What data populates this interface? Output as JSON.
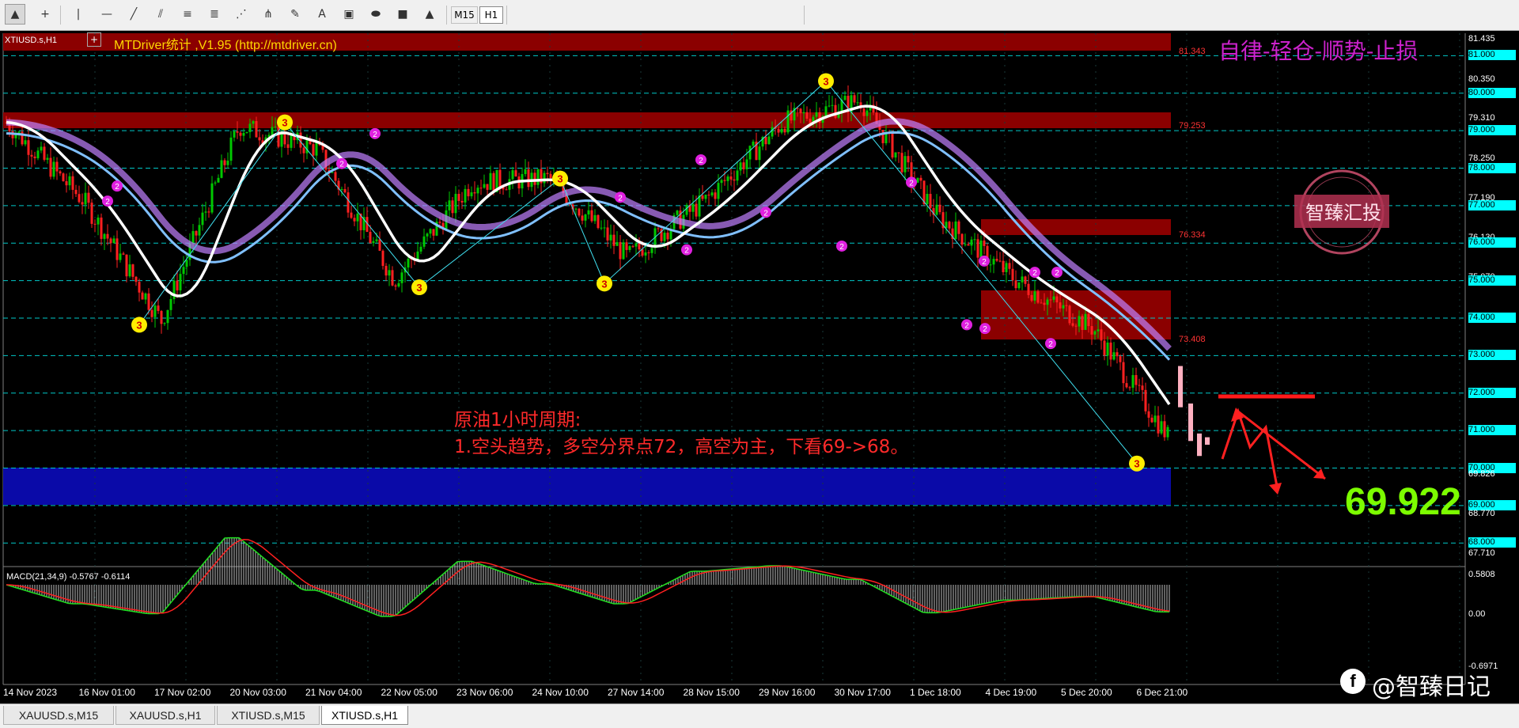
{
  "toolbar": {
    "timeframes": [
      "M15",
      "H1"
    ],
    "active_timeframe": "H1"
  },
  "chart": {
    "symbol": "XTIUSD.s,H1",
    "indicator_label": "MTDriver统计 ,V1.95 (http://mtdriver.cn)",
    "motto": "自律-轻仓-顺势-止损",
    "stamp": "智臻汇投",
    "price_big": "69.922",
    "annotation_title": "原油1小时周期:",
    "annotation_body": "1.空头趋势，多空分界点72，高空为主，下看69->68。",
    "macd_label": "MACD(21,34,9) -0.5767 -0.6114",
    "watermark": "@智臻日记",
    "price_levels": [
      "81.435",
      "81.000",
      "80.350",
      "80.000",
      "79.310",
      "79.000",
      "78.250",
      "78.000",
      "77.190",
      "77.000",
      "76.130",
      "76.000",
      "75.070",
      "75.000",
      "74.000",
      "73.000",
      "72.000",
      "71.000",
      "70.000",
      "69.826",
      "69.000",
      "68.770",
      "68.000",
      "67.710"
    ],
    "highlighted_levels": [
      "81.000",
      "80.000",
      "79.000",
      "78.000",
      "77.000",
      "76.000",
      "75.000",
      "74.000",
      "73.000",
      "72.000",
      "71.000",
      "70.000",
      "69.000",
      "68.000"
    ],
    "zone_labels": [
      "81.343",
      "79.253",
      "76.334",
      "73.408"
    ],
    "macd_levels": [
      "0.5808",
      "0.00",
      "-0.6971"
    ],
    "time_labels": [
      "14 Nov 2023",
      "16 Nov 01:00",
      "17 Nov 02:00",
      "20 Nov 03:00",
      "21 Nov 04:00",
      "22 Nov 05:00",
      "23 Nov 06:00",
      "24 Nov 10:00",
      "27 Nov 14:00",
      "28 Nov 15:00",
      "29 Nov 16:00",
      "30 Nov 17:00",
      "1 Dec 18:00",
      "4 Dec 19:00",
      "5 Dec 20:00",
      "6 Dec 21:00"
    ]
  },
  "tabs": [
    "XAUUSD.s,M15",
    "XAUUSD.s,H1",
    "XTIUSD.s,M15",
    "XTIUSD.s,H1"
  ],
  "active_tab": "XTIUSD.s,H1",
  "colors": {
    "zone_red": "#8b0000",
    "zone_blue": "#0a0aa8",
    "grid_cyan": "#00c8c8",
    "ma_white": "#ffffff",
    "macd_red": "#ff2020",
    "macd_green": "#20e020",
    "bull_candle": "#00c800",
    "bear_candle": "#ff2020",
    "marker_yellow": "#ffee00",
    "marker_magenta": "#e020e0"
  },
  "chart_data": {
    "type": "candlestick",
    "symbol": "XTIUSD.s",
    "timeframe": "H1",
    "close_path": {
      "x": [
        "14 Nov 2023",
        "16 Nov 01:00",
        "17 Nov 02:00",
        "20 Nov 03:00",
        "21 Nov 04:00",
        "22 Nov 05:00",
        "23 Nov 06:00",
        "24 Nov 10:00",
        "27 Nov 14:00",
        "28 Nov 15:00",
        "29 Nov 16:00",
        "30 Nov 17:00",
        "1 Dec 18:00",
        "4 Dec 19:00",
        "5 Dec 20:00",
        "6 Dec 21:00"
      ],
      "values": [
        78.4,
        76.3,
        73.1,
        78.3,
        77.7,
        74.2,
        76.8,
        76.9,
        74.8,
        76.3,
        78.4,
        79.0,
        75.9,
        74.2,
        72.9,
        69.9
      ]
    },
    "ylim": [
      67.5,
      81.6
    ],
    "key_level": 72.0,
    "targets": [
      69.0,
      68.0
    ],
    "last_price": 69.922
  }
}
